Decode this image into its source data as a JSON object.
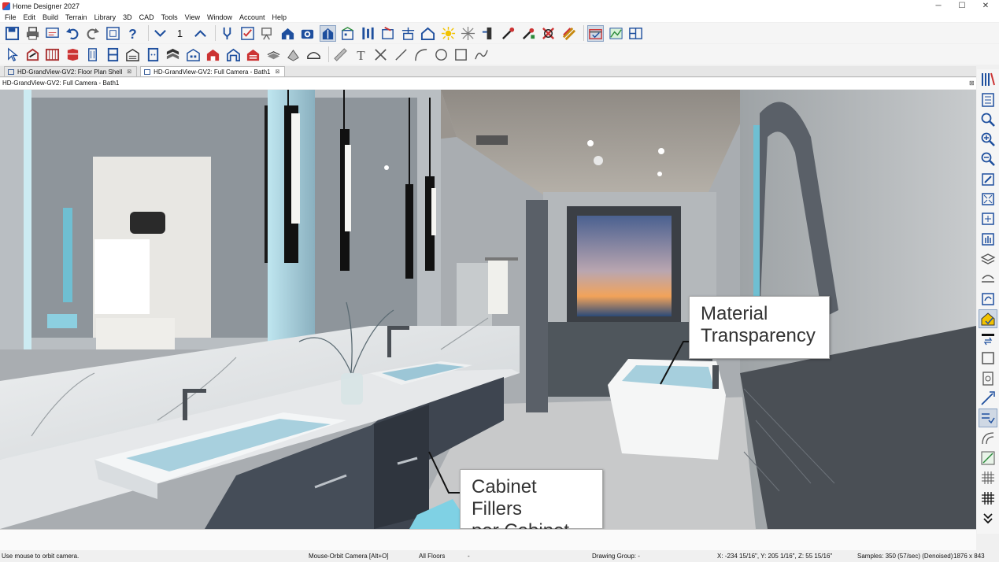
{
  "window": {
    "title": "Home Designer 2027",
    "min": "─",
    "max": "☐",
    "close": "✕"
  },
  "menu": [
    "File",
    "Edit",
    "Build",
    "Terrain",
    "Library",
    "3D",
    "CAD",
    "Tools",
    "View",
    "Window",
    "Account",
    "Help"
  ],
  "toolbar1": {
    "icons": [
      "save-icon",
      "print-icon",
      "print-preview-icon",
      "undo-icon",
      "redo-icon",
      "plan-icon",
      "help-icon",
      "down-floor-icon",
      "floor-number",
      "up-floor-icon",
      "tools-icon",
      "checklist-icon",
      "camera-dolly-icon",
      "house-icon",
      "camera-icon",
      "doll-house-icon",
      "elevation-icon",
      "cross-section-icon",
      "full-camera-icon",
      "cutaway-icon",
      "perspective-icon",
      "light-icon",
      "raytrace-icon",
      "layer-icon",
      "eyedropper-icon",
      "material-painter-icon",
      "delete-material-icon",
      "adjust-material-icon",
      "render-settings-icon",
      "terrain-view-icon",
      "split-view-icon"
    ],
    "floor_number": "1"
  },
  "toolbar2": {
    "icons": [
      "select-icon",
      "wall-tool-icon",
      "railing-icon",
      "cabinet-icon",
      "door-icon",
      "window-tool-icon",
      "stairs-icon",
      "wardrobe-icon",
      "roof-icon",
      "library-icon",
      "fixture-icon",
      "opening-icon",
      "garage-icon",
      "deck-icon",
      "slab-icon",
      "shape-icon",
      "dimension-icon",
      "text-icon",
      "delete-icon",
      "line-icon",
      "arc-icon",
      "circle-icon",
      "rectangle-icon",
      "spline-icon"
    ]
  },
  "tabs": [
    {
      "label": "HD-GrandView-GV2: Floor Plan Shell",
      "close": "⊠"
    },
    {
      "label": "HD-GrandView-GV2: Full Camera - Bath1",
      "close": "⊠"
    }
  ],
  "view": {
    "label": "HD-GrandView-GV2: Full Camera - Bath1",
    "close": "⊠"
  },
  "right_toolbar": [
    "library-browser-icon",
    "project-browser-icon",
    "zoom-icon",
    "zoom-in-icon",
    "zoom-out-icon",
    "undo-zoom-icon",
    "fill-window-icon",
    "fill-all-icon",
    "pan-icon",
    "layer-control-icon",
    "orbit-icon",
    "rotate-view-icon",
    "display-options-icon",
    "swap-icon",
    "active-layer-icon",
    "page-icon",
    "print-preview-icon",
    "arc-tool-icon",
    "angle-snap-icon",
    "curve-icon",
    "object-snap-icon",
    "grid-icon",
    "grid-snap-icon",
    "more-icon"
  ],
  "callouts": [
    {
      "line1": "Material",
      "line2": "Transparency"
    },
    {
      "line1": "Cabinet Fillers",
      "line2": "per Cabinet"
    }
  ],
  "status": {
    "hint": "Use mouse to orbit camera.",
    "mode": "Mouse-Orbit Camera [Alt+O]",
    "floors": "All Floors",
    "dash": "-",
    "drawing_group": "Drawing Group: -",
    "coords": "X: -234 15/16\", Y: 205 1/16\", Z: 55 15/16\"",
    "samples": "Samples: 350 (57/sec) (Denoised)",
    "size": "1876 x 843"
  }
}
